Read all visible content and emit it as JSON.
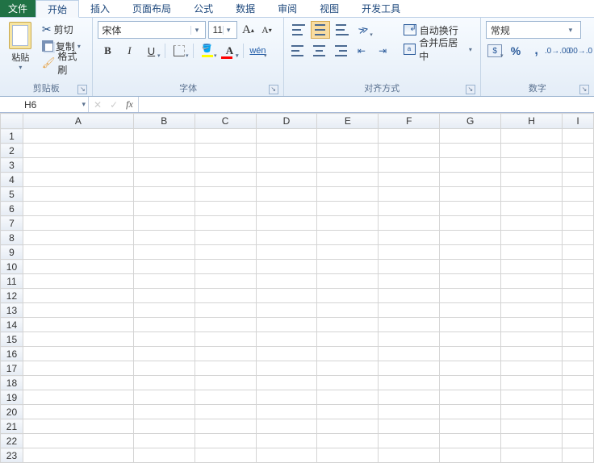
{
  "tabs": {
    "file": "文件",
    "items": [
      "开始",
      "插入",
      "页面布局",
      "公式",
      "数据",
      "审阅",
      "视图",
      "开发工具"
    ],
    "active": 0
  },
  "clipboard": {
    "paste": "粘贴",
    "cut": "剪切",
    "copy": "复制",
    "format_painter": "格式刷",
    "group_label": "剪贴板"
  },
  "font": {
    "name": "宋体",
    "size": "11",
    "bold": "B",
    "italic": "I",
    "underline": "U",
    "wen": "wén",
    "group_label": "字体",
    "grow": "A",
    "shrink": "A"
  },
  "alignment": {
    "wrap": "自动换行",
    "merge": "合并后居中",
    "group_label": "对齐方式"
  },
  "number": {
    "format": "常规",
    "percent": "%",
    "comma": ",",
    "group_label": "数字"
  },
  "formula_bar": {
    "cell_ref": "H6",
    "fx": "fx",
    "value": ""
  },
  "columns": [
    "A",
    "B",
    "C",
    "D",
    "E",
    "F",
    "G",
    "H",
    "I"
  ],
  "rows": [
    "1",
    "2",
    "3",
    "4",
    "5",
    "6",
    "7",
    "8",
    "9",
    "10",
    "11",
    "12",
    "13",
    "14",
    "15",
    "16",
    "17",
    "18",
    "19",
    "20",
    "21",
    "22",
    "23"
  ]
}
